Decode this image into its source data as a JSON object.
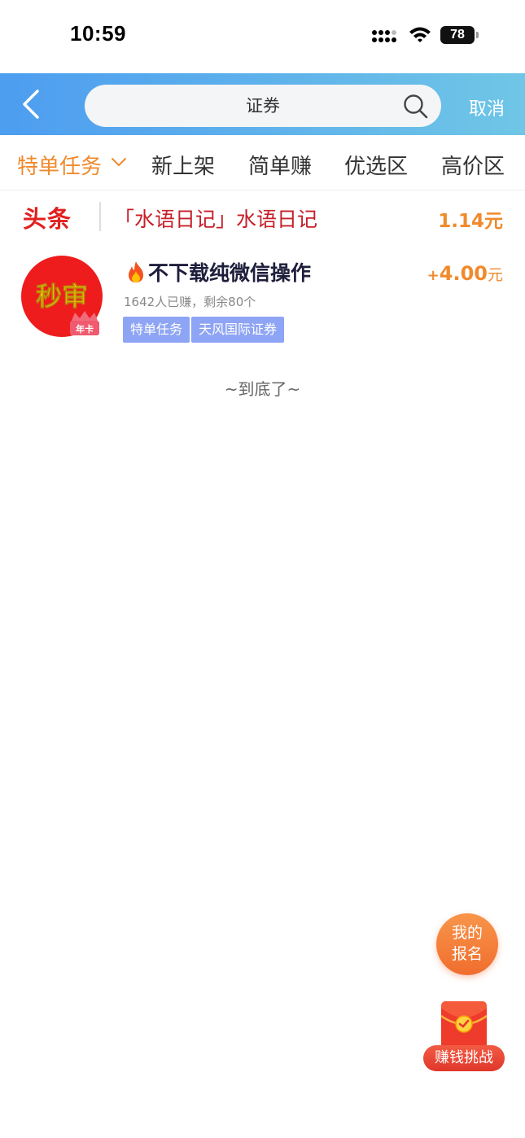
{
  "status_bar": {
    "time": "10:59",
    "battery": "78"
  },
  "search": {
    "query": "证券",
    "cancel_label": "取消"
  },
  "tabs": [
    {
      "label": "特单任务",
      "active": true
    },
    {
      "label": "新上架",
      "active": false
    },
    {
      "label": "简单赚",
      "active": false
    },
    {
      "label": "优选区",
      "active": false
    },
    {
      "label": "高价区",
      "active": false
    }
  ],
  "headline": {
    "logo": "头条",
    "text": "「水语日记」水语日记",
    "price": "1.14元"
  },
  "task": {
    "avatar_text": "秒审",
    "avatar_badge": "年卡",
    "title": "不下载纯微信操作",
    "meta": "1642人已赚，剩余80个",
    "tags": [
      "特单任务",
      "天风国际证券"
    ],
    "price_plus": "+",
    "price_amount": "4.00",
    "price_unit": "元"
  },
  "end_text": "~到底了~",
  "floating": {
    "my_signup_line1": "我的",
    "my_signup_line2": "报名",
    "earn_challenge": "赚钱挑战"
  },
  "colors": {
    "accent_orange": "#f08a2c",
    "header_gradient_start": "#4d9df0",
    "header_gradient_end": "#6fc6e6",
    "tag_blue": "#8ea4f4",
    "headline_red": "#c6202a"
  }
}
